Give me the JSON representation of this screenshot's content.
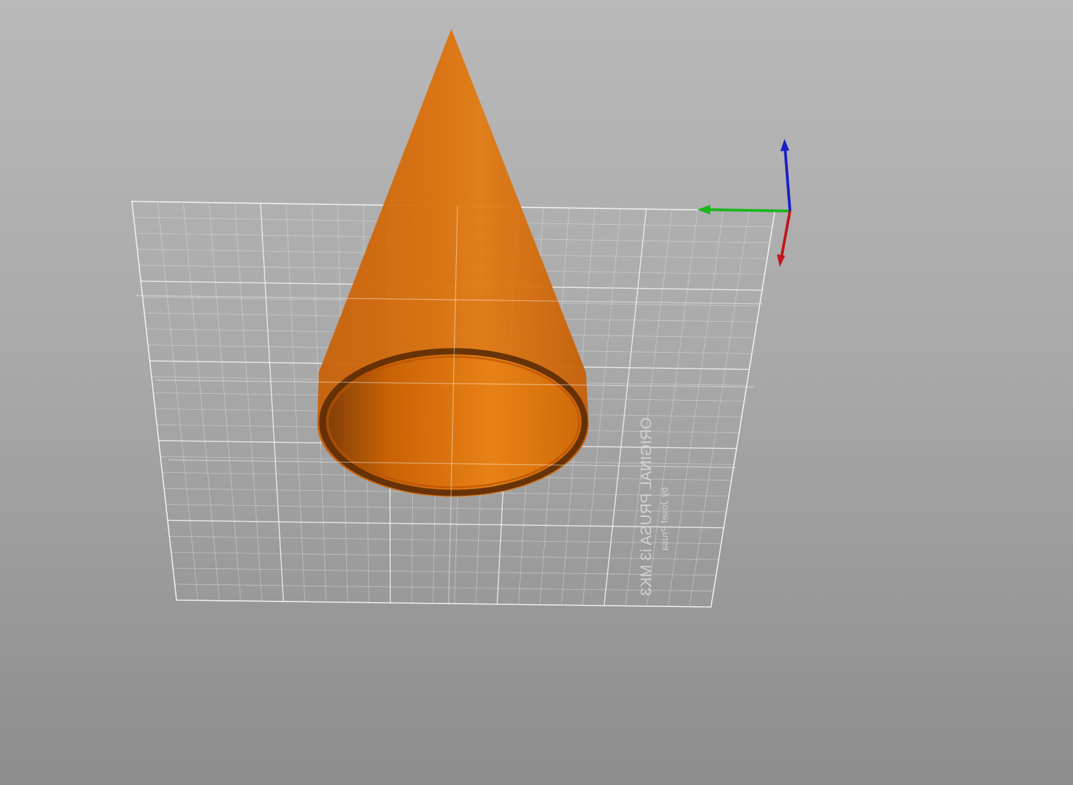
{
  "viewport": {
    "background_top": "#b9b9b9",
    "background_bottom": "#8d8d8d"
  },
  "bed": {
    "logo_line1": "ORIGINAL PRUSA i3 MK3",
    "logo_line2": "by Josef Prusa",
    "grid_color": "#f2f2f2"
  },
  "model": {
    "shape": "cone",
    "color": "#e07410",
    "rim_color": "#5a2a05"
  },
  "axes": {
    "x_color": "#c0151b",
    "y_color": "#19b81c",
    "z_color": "#1a1fc4"
  }
}
